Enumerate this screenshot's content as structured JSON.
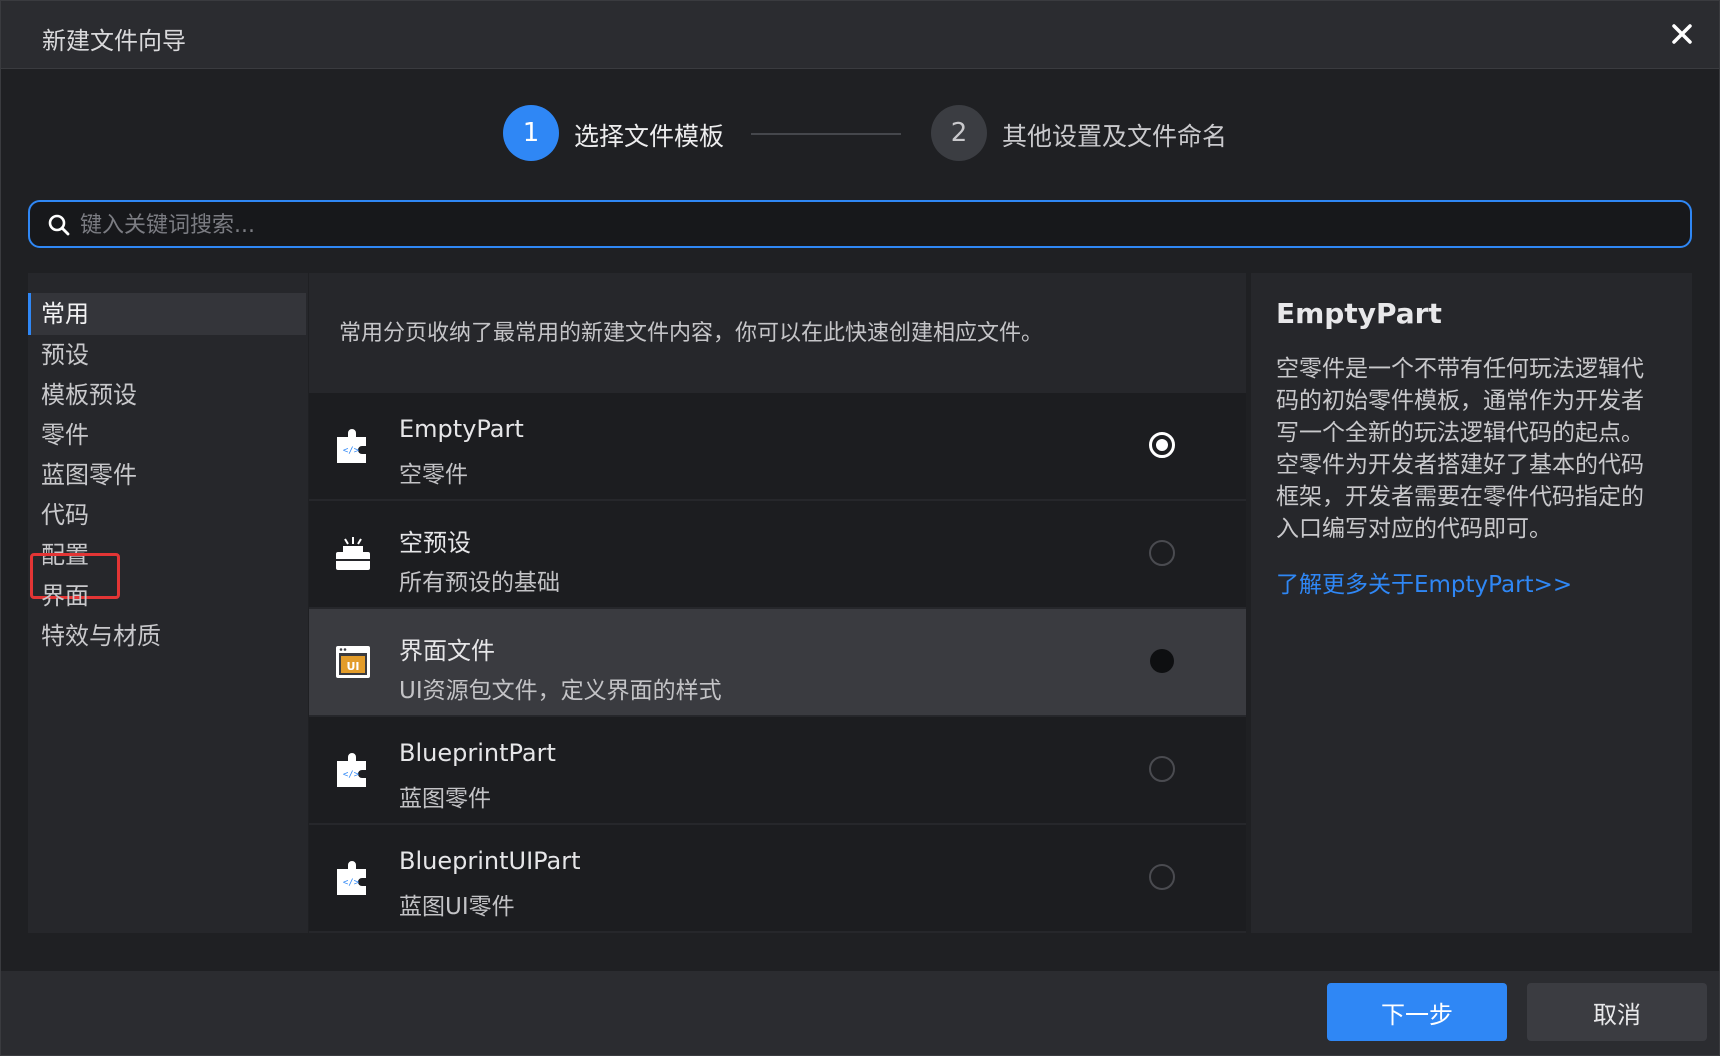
{
  "window": {
    "title": "新建文件向导"
  },
  "steps": [
    {
      "number": "1",
      "label": "选择文件模板"
    },
    {
      "number": "2",
      "label": "其他设置及文件命名"
    }
  ],
  "search": {
    "placeholder": "键入关键词搜索..."
  },
  "sidebar": {
    "items": [
      {
        "label": "常用"
      },
      {
        "label": "预设"
      },
      {
        "label": "模板预设"
      },
      {
        "label": "零件"
      },
      {
        "label": "蓝图零件"
      },
      {
        "label": "代码"
      },
      {
        "label": "配置"
      },
      {
        "label": "界面"
      },
      {
        "label": "特效与材质"
      }
    ]
  },
  "main": {
    "description": "常用分页收纳了最常用的新建文件内容，你可以在此快速创建相应文件。",
    "templates": [
      {
        "title": "EmptyPart",
        "subtitle": "空零件",
        "icon": "puzzle-code-icon"
      },
      {
        "title": "空预设",
        "subtitle": "所有预设的基础",
        "icon": "prefab-icon"
      },
      {
        "title": "界面文件",
        "subtitle": "UI资源包文件，定义界面的样式",
        "icon": "ui-file-icon"
      },
      {
        "title": "BlueprintPart",
        "subtitle": "蓝图零件",
        "icon": "puzzle-code-icon"
      },
      {
        "title": "BlueprintUIPart",
        "subtitle": "蓝图UI零件",
        "icon": "puzzle-code-icon"
      }
    ]
  },
  "detail": {
    "title": "EmptyPart",
    "description": "空零件是一个不带有任何玩法逻辑代码的初始零件模板，通常作为开发者写一个全新的玩法逻辑代码的起点。空零件为开发者搭建好了基本的代码框架，开发者需要在零件代码指定的入口编写对应的代码即可。",
    "link": "了解更多关于EmptyPart>>"
  },
  "footer": {
    "next_label": "下一步",
    "cancel_label": "取消"
  },
  "colors": {
    "accent": "#2f87f5",
    "highlight": "#e33535"
  }
}
